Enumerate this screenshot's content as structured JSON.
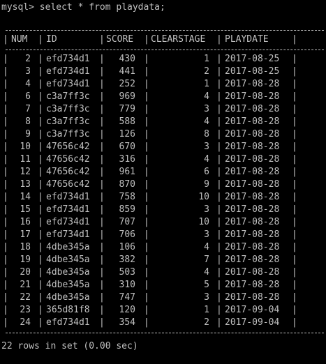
{
  "terminal": {
    "prompt": "mysql>",
    "command": "select * from playdata;",
    "footer": "22 rows in set (0.00 sec)"
  },
  "table": {
    "columns": [
      "NUM",
      "ID",
      "SCORE",
      "CLEARSTAGE",
      "PLAYDATE"
    ],
    "rows": [
      [
        "2",
        "efd734d1",
        "430",
        "1",
        "2017-08-25"
      ],
      [
        "3",
        "efd734d1",
        "441",
        "2",
        "2017-08-25"
      ],
      [
        "4",
        "efd734d1",
        "252",
        "1",
        "2017-08-28"
      ],
      [
        "6",
        "c3a7ff3c",
        "969",
        "4",
        "2017-08-28"
      ],
      [
        "7",
        "c3a7ff3c",
        "779",
        "3",
        "2017-08-28"
      ],
      [
        "8",
        "c3a7ff3c",
        "588",
        "4",
        "2017-08-28"
      ],
      [
        "9",
        "c3a7ff3c",
        "126",
        "8",
        "2017-08-28"
      ],
      [
        "10",
        "47656c42",
        "670",
        "3",
        "2017-08-28"
      ],
      [
        "11",
        "47656c42",
        "316",
        "4",
        "2017-08-28"
      ],
      [
        "12",
        "47656c42",
        "961",
        "6",
        "2017-08-28"
      ],
      [
        "13",
        "47656c42",
        "870",
        "9",
        "2017-08-28"
      ],
      [
        "14",
        "efd734d1",
        "758",
        "10",
        "2017-08-28"
      ],
      [
        "15",
        "efd734d1",
        "859",
        "3",
        "2017-08-28"
      ],
      [
        "16",
        "efd734d1",
        "707",
        "10",
        "2017-08-28"
      ],
      [
        "17",
        "efd734d1",
        "706",
        "3",
        "2017-08-28"
      ],
      [
        "18",
        "4dbe345a",
        "106",
        "4",
        "2017-08-28"
      ],
      [
        "19",
        "4dbe345a",
        "382",
        "7",
        "2017-08-28"
      ],
      [
        "20",
        "4dbe345a",
        "503",
        "4",
        "2017-08-28"
      ],
      [
        "21",
        "4dbe345a",
        "310",
        "5",
        "2017-08-28"
      ],
      [
        "22",
        "4dbe345a",
        "747",
        "3",
        "2017-08-28"
      ],
      [
        "23",
        "365d81f8",
        "120",
        "1",
        "2017-09-04"
      ],
      [
        "24",
        "efd734d1",
        "354",
        "2",
        "2017-09-04"
      ]
    ]
  },
  "colors": {
    "background": "#000000",
    "text": "#c0c0c0"
  }
}
